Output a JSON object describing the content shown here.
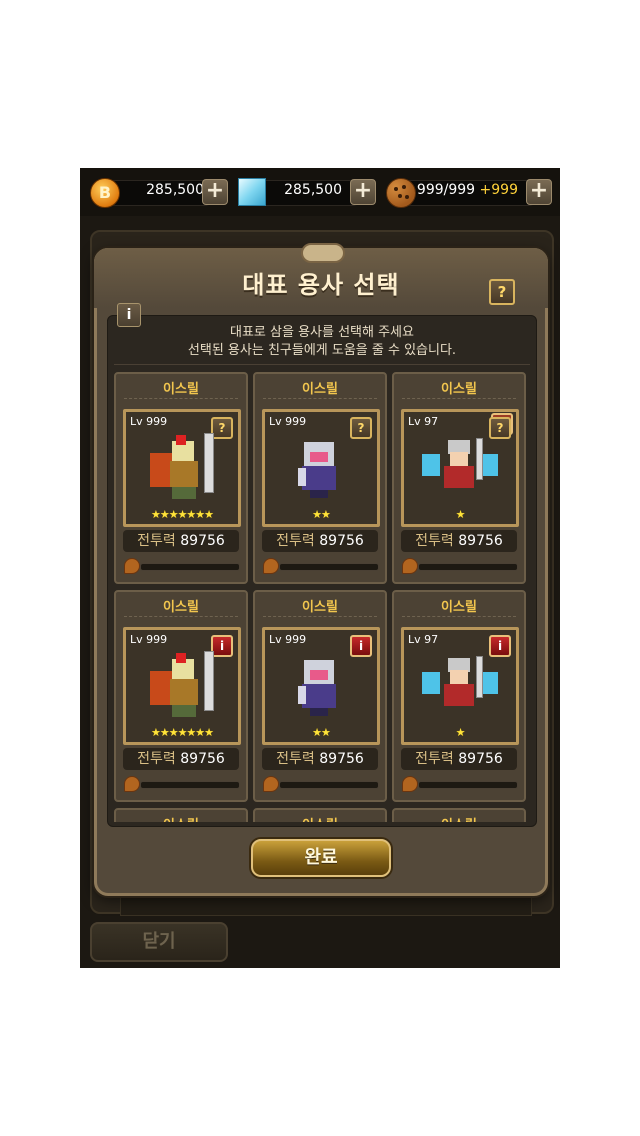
{
  "currencies": {
    "coin": {
      "value": "285,500",
      "icon": "coin-icon"
    },
    "gem": {
      "value": "285,500",
      "icon": "gem-icon"
    },
    "cookie": {
      "value": "999/999",
      "bonus": "+999",
      "icon": "cookie-icon"
    },
    "plus": "+"
  },
  "background": {
    "close_label": "닫기"
  },
  "dialog": {
    "title": "대표 용사 선택",
    "help": "?",
    "info": "i",
    "desc_line1": "대표로 삼을 용사를 선택해 주세요",
    "desc_line2": "선택된 용사는 친구들에게 도움을 줄 수 있습니다.",
    "confirm_label": "완료"
  },
  "heroes": [
    {
      "name": "이스릴",
      "level": "Lv 999",
      "badge": "?",
      "stars": "★★★★★★★",
      "power_label": "전투력",
      "power": "89756"
    },
    {
      "name": "이스릴",
      "level": "Lv 999",
      "badge": "?",
      "stars": "★★",
      "power_label": "전투력",
      "power": "89756"
    },
    {
      "name": "이스릴",
      "level": "Lv 97",
      "badge": "?",
      "stars": "★",
      "power_label": "전투력",
      "power": "89756"
    },
    {
      "name": "이스릴",
      "level": "Lv 999",
      "badge": "i",
      "stars": "★★★★★★★",
      "power_label": "전투력",
      "power": "89756"
    },
    {
      "name": "이스릴",
      "level": "Lv 999",
      "badge": "i",
      "stars": "★★",
      "power_label": "전투력",
      "power": "89756"
    },
    {
      "name": "이스릴",
      "level": "Lv 97",
      "badge": "i",
      "stars": "★",
      "power_label": "전투력",
      "power": "89756"
    },
    {
      "name": "이스릴"
    },
    {
      "name": "이스릴"
    },
    {
      "name": "이스릴"
    }
  ]
}
